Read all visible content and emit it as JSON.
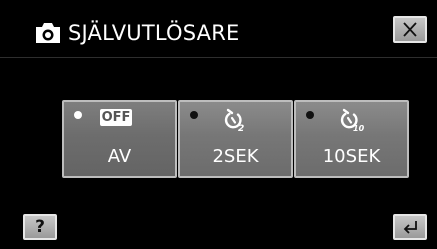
{
  "header": {
    "title": "SJÄLVUTLÖSARE",
    "camera_icon": "camera-icon",
    "close_icon": "close-icon"
  },
  "options": [
    {
      "label": "AV",
      "badge": "OFF",
      "icon": "off-badge",
      "selected": true
    },
    {
      "label": "2SEK",
      "icon": "self-timer-2-icon",
      "timer_subscript": "2",
      "selected": false
    },
    {
      "label": "10SEK",
      "icon": "self-timer-10-icon",
      "timer_subscript": "10",
      "selected": false
    }
  ],
  "footer": {
    "help_label": "?",
    "back_icon": "back-arrow-icon"
  },
  "colors": {
    "background": "#000000",
    "option_fill": "#777777",
    "option_border": "#bdbdbd",
    "button_fill": "#b0b0b0"
  }
}
